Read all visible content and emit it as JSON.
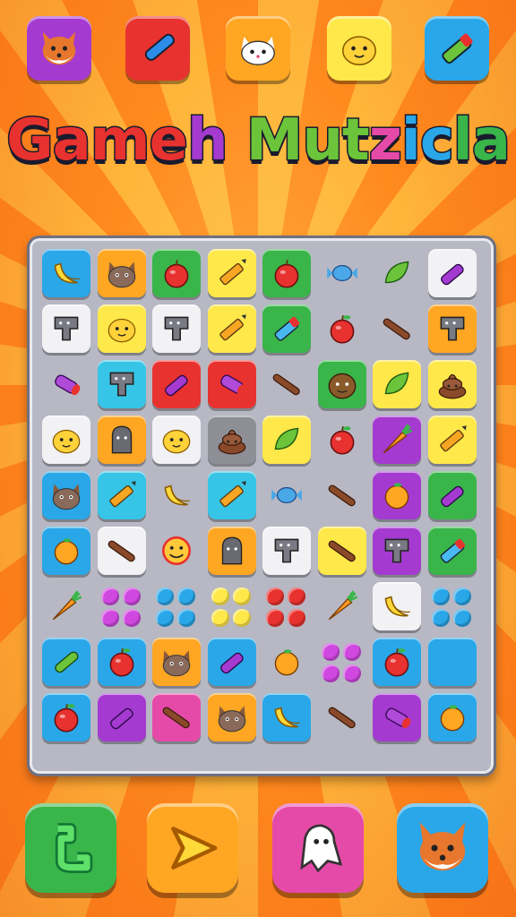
{
  "game": {
    "title_parts": [
      "Game",
      "h",
      " ",
      "Mut",
      "z",
      "ic",
      "la"
    ],
    "title_colors": [
      "#e8322f",
      "#a53ad0",
      "#ffffff",
      "#6bc43a",
      "#e64aa8",
      "#2aa7e8",
      "#39b54a"
    ]
  },
  "top_bar": {
    "buttons": [
      {
        "icon": "fox-icon",
        "color": "#a53ad0"
      },
      {
        "icon": "crayon-icon",
        "color": "#e8322f"
      },
      {
        "icon": "cat-icon",
        "color": "#ffa623"
      },
      {
        "icon": "chick-icon",
        "color": "#ffe84a"
      },
      {
        "icon": "marker-icon",
        "color": "#2aa7e8"
      }
    ]
  },
  "board": {
    "rows": [
      [
        [
          "blue",
          "banana"
        ],
        [
          "orange",
          "cat"
        ],
        [
          "green",
          "apple"
        ],
        [
          "yellow",
          "pencil"
        ],
        [
          "green",
          "apple"
        ],
        [
          "none",
          "candy"
        ],
        [
          "none",
          "leaf"
        ],
        [
          "white",
          "crayon"
        ]
      ],
      [
        [
          "white",
          "puzzle"
        ],
        [
          "yellow",
          "chick"
        ],
        [
          "white",
          "puzzle"
        ],
        [
          "yellow",
          "pencil"
        ],
        [
          "green",
          "marker"
        ],
        [
          "none",
          "apple"
        ],
        [
          "none",
          "stick"
        ],
        [
          "orange",
          "puzzle"
        ]
      ],
      [
        [
          "none",
          "tube"
        ],
        [
          "cyan",
          "puzzle"
        ],
        [
          "red",
          "crayon"
        ],
        [
          "red",
          "tube"
        ],
        [
          "none",
          "stick"
        ],
        [
          "green",
          "monster"
        ],
        [
          "yellow",
          "leaf"
        ],
        [
          "yellow",
          "poop"
        ]
      ],
      [
        [
          "white",
          "chick"
        ],
        [
          "orange",
          "ghost"
        ],
        [
          "white",
          "chick"
        ],
        [
          "gray",
          "poop"
        ],
        [
          "yellow",
          "leaf"
        ],
        [
          "none",
          "apple"
        ],
        [
          "purple",
          "carrot"
        ],
        [
          "yellow",
          "pencil"
        ]
      ],
      [
        [
          "blue",
          "cat"
        ],
        [
          "cyan",
          "pencil"
        ],
        [
          "none",
          "banana"
        ],
        [
          "cyan",
          "pencil"
        ],
        [
          "none",
          "candy"
        ],
        [
          "none",
          "stick"
        ],
        [
          "purple",
          "orange"
        ],
        [
          "green",
          "crayon"
        ]
      ],
      [
        [
          "blue",
          "orange"
        ],
        [
          "white",
          "stick"
        ],
        [
          "none",
          "smiley"
        ],
        [
          "orange",
          "ghost"
        ],
        [
          "white",
          "puzzle"
        ],
        [
          "yellow",
          "stick"
        ],
        [
          "purple",
          "puzzle"
        ],
        [
          "green",
          "marker"
        ]
      ],
      [
        [
          "none",
          "carrot"
        ],
        [
          "none",
          "dots"
        ],
        [
          "none",
          "dots"
        ],
        [
          "none",
          "dots"
        ],
        [
          "none",
          "dots"
        ],
        [
          "none",
          "carrot"
        ],
        [
          "white",
          "banana"
        ],
        [
          "none",
          "dots"
        ]
      ],
      [
        [
          "blue",
          "bean"
        ],
        [
          "blue",
          "apple"
        ],
        [
          "orange",
          "cat"
        ],
        [
          "blue",
          "crayon"
        ],
        [
          "none",
          "orange"
        ],
        [
          "none",
          "dots"
        ],
        [
          "blue",
          "apple"
        ],
        [
          "blue",
          "blank"
        ]
      ],
      [
        [
          "blue",
          "apple"
        ],
        [
          "purple",
          "crayon"
        ],
        [
          "pink",
          "stick"
        ],
        [
          "orange",
          "cat"
        ],
        [
          "blue",
          "banana"
        ],
        [
          "none",
          "stick"
        ],
        [
          "purple",
          "tube"
        ],
        [
          "blue",
          "orange"
        ]
      ]
    ]
  },
  "bottom_bar": {
    "buttons": [
      {
        "icon": "swirl-icon",
        "color": "#39b54a"
      },
      {
        "icon": "play-icon",
        "color": "#ffa623"
      },
      {
        "icon": "ghost-icon",
        "color": "#e64aa8"
      },
      {
        "icon": "fox-icon",
        "color": "#2aa7e8"
      }
    ]
  }
}
